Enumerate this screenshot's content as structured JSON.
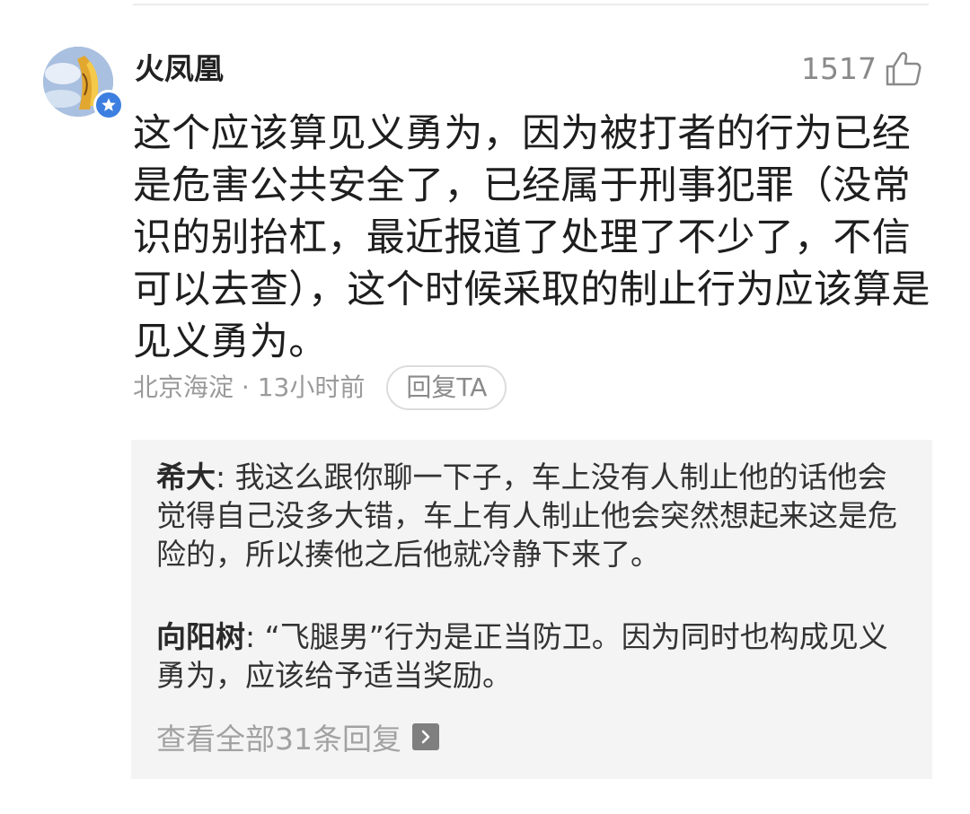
{
  "comment": {
    "username": "火凤凰",
    "like_count": "1517",
    "body": "这个应该算见义勇为，因为被打者的行为已经是危害公共安全了，已经属于刑事犯罪（没常识的别抬杠，最近报道了处理了不少了，不信可以去查），这个时候采取的制止行为应该算是见义勇为。",
    "location_time": "北京海淀 · 13小时前",
    "reply_button_label": "回复TA",
    "icons": {
      "avatar": "user-avatar",
      "verified": "verified-star-icon",
      "like": "thumbs-up-icon"
    }
  },
  "replies": [
    {
      "author": "希大",
      "separator": ": ",
      "text": "我这么跟你聊一下子，车上没有人制止他的话他会觉得自己没多大错，车上有人制止他会突然想起来这是危险的，所以揍他之后他就冷静下来了。"
    },
    {
      "author": "向阳树",
      "separator": ": ",
      "text": "“飞腿男”行为是正当防卫。因为同时也构成见义勇为，应该给予适当奖励。"
    }
  ],
  "view_all_label": "查看全部31条回复",
  "colors": {
    "verified_badge": "#3d7fe0",
    "reply_background": "#f4f4f5",
    "muted_text": "#9a9a9a"
  }
}
